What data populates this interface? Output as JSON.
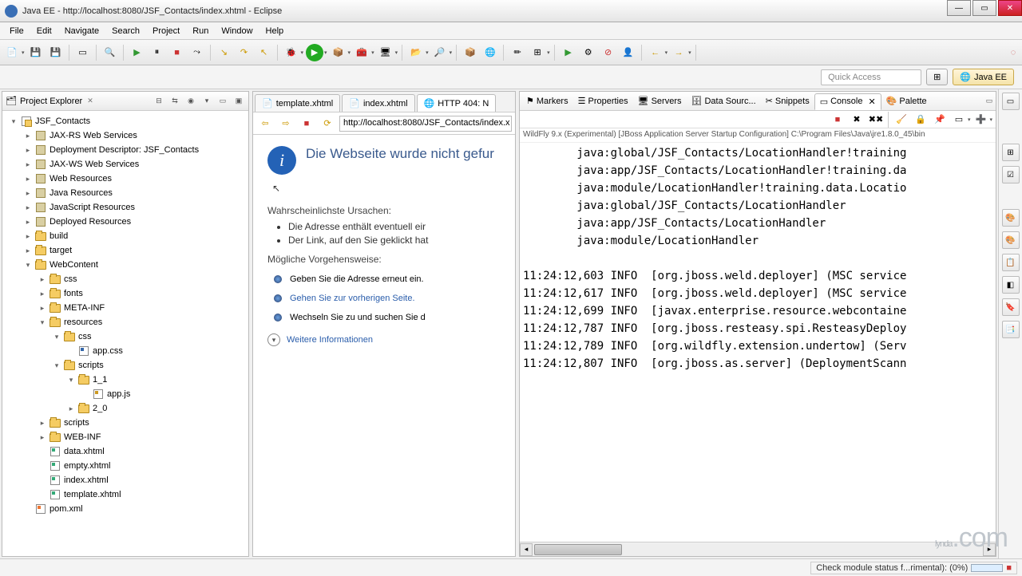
{
  "window": {
    "title": "Java EE - http://localhost:8080/JSF_Contacts/index.xhtml - Eclipse"
  },
  "menu": [
    "File",
    "Edit",
    "Navigate",
    "Search",
    "Project",
    "Run",
    "Window",
    "Help"
  ],
  "perspective": {
    "quick_access": "Quick Access",
    "javaee": "Java EE"
  },
  "explorer": {
    "title": "Project Explorer",
    "tree": [
      {
        "depth": 0,
        "exp": "▾",
        "icon": "prj",
        "label": "JSF_Contacts"
      },
      {
        "depth": 1,
        "exp": "▸",
        "icon": "lib",
        "label": "JAX-RS Web Services"
      },
      {
        "depth": 1,
        "exp": "▸",
        "icon": "lib",
        "label": "Deployment Descriptor: JSF_Contacts"
      },
      {
        "depth": 1,
        "exp": "▸",
        "icon": "lib",
        "label": "JAX-WS Web Services"
      },
      {
        "depth": 1,
        "exp": "▸",
        "icon": "lib",
        "label": "Web Resources"
      },
      {
        "depth": 1,
        "exp": "▸",
        "icon": "lib",
        "label": "Java Resources"
      },
      {
        "depth": 1,
        "exp": "▸",
        "icon": "lib",
        "label": "JavaScript Resources"
      },
      {
        "depth": 1,
        "exp": "▸",
        "icon": "lib",
        "label": "Deployed Resources"
      },
      {
        "depth": 1,
        "exp": "▸",
        "icon": "folder",
        "label": "build"
      },
      {
        "depth": 1,
        "exp": "▸",
        "icon": "folder",
        "label": "target"
      },
      {
        "depth": 1,
        "exp": "▾",
        "icon": "folder",
        "label": "WebContent"
      },
      {
        "depth": 2,
        "exp": "▸",
        "icon": "folder",
        "label": "css"
      },
      {
        "depth": 2,
        "exp": "▸",
        "icon": "folder",
        "label": "fonts"
      },
      {
        "depth": 2,
        "exp": "▸",
        "icon": "folder",
        "label": "META-INF"
      },
      {
        "depth": 2,
        "exp": "▾",
        "icon": "folder",
        "label": "resources"
      },
      {
        "depth": 3,
        "exp": "▾",
        "icon": "folder",
        "label": "css"
      },
      {
        "depth": 4,
        "exp": "",
        "icon": "css",
        "label": "app.css"
      },
      {
        "depth": 3,
        "exp": "▾",
        "icon": "folder",
        "label": "scripts"
      },
      {
        "depth": 4,
        "exp": "▾",
        "icon": "folder",
        "label": "1_1"
      },
      {
        "depth": 5,
        "exp": "",
        "icon": "js",
        "label": "app.js"
      },
      {
        "depth": 4,
        "exp": "▸",
        "icon": "folder",
        "label": "2_0"
      },
      {
        "depth": 2,
        "exp": "▸",
        "icon": "folder",
        "label": "scripts"
      },
      {
        "depth": 2,
        "exp": "▸",
        "icon": "folder",
        "label": "WEB-INF"
      },
      {
        "depth": 2,
        "exp": "",
        "icon": "xh",
        "label": "data.xhtml"
      },
      {
        "depth": 2,
        "exp": "",
        "icon": "xh",
        "label": "empty.xhtml"
      },
      {
        "depth": 2,
        "exp": "",
        "icon": "xh",
        "label": "index.xhtml"
      },
      {
        "depth": 2,
        "exp": "",
        "icon": "xh",
        "label": "template.xhtml"
      },
      {
        "depth": 1,
        "exp": "",
        "icon": "xml",
        "label": "pom.xml"
      }
    ]
  },
  "editor": {
    "tabs": [
      {
        "label": "template.xhtml",
        "active": false
      },
      {
        "label": "index.xhtml",
        "active": false
      },
      {
        "label": "HTTP 404: N",
        "active": true
      }
    ],
    "address": "http://localhost:8080/JSF_Contacts/index.x"
  },
  "error_page": {
    "title": "Die Webseite wurde nicht gefur",
    "causes_heading": "Wahrscheinlichste Ursachen:",
    "causes": [
      "Die Adresse enthält eventuell eir",
      "Der Link, auf den Sie geklickt hat"
    ],
    "actions_heading": "Mögliche Vorgehensweise:",
    "actions": [
      "Geben Sie die Adresse erneut ein.",
      "Gehen Sie zur vorherigen Seite.",
      "Wechseln Sie zu  und suchen Sie d"
    ],
    "more": "Weitere Informationen"
  },
  "views": {
    "tabs": [
      "Markers",
      "Properties",
      "Servers",
      "Data Sourc...",
      "Snippets",
      "Console",
      "Palette"
    ],
    "active": 5
  },
  "console": {
    "desc": "WildFly 9.x (Experimental) [JBoss Application Server Startup Configuration] C:\\Program Files\\Java\\jre1.8.0_45\\bin",
    "lines": [
      "        java:global/JSF_Contacts/LocationHandler!training",
      "        java:app/JSF_Contacts/LocationHandler!training.da",
      "        java:module/LocationHandler!training.data.Locatio",
      "        java:global/JSF_Contacts/LocationHandler",
      "        java:app/JSF_Contacts/LocationHandler",
      "        java:module/LocationHandler",
      "",
      "11:24:12,603 INFO  [org.jboss.weld.deployer] (MSC service",
      "11:24:12,617 INFO  [org.jboss.weld.deployer] (MSC service",
      "11:24:12,699 INFO  [javax.enterprise.resource.webcontaine",
      "11:24:12,787 INFO  [org.jboss.resteasy.spi.ResteasyDeploy",
      "11:24:12,789 INFO  [org.wildfly.extension.undertow] (Serv",
      "11:24:12,807 INFO  [org.jboss.as.server] (DeploymentScann"
    ]
  },
  "status": {
    "text": "Check module status f...rimental): (0%)"
  },
  "watermark": "lynda.com"
}
